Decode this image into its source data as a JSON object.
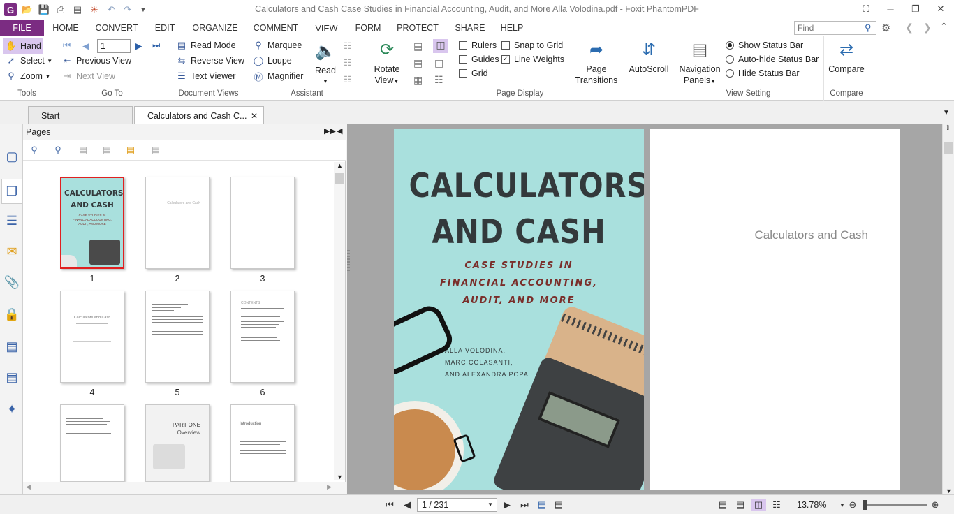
{
  "window": {
    "title": "Calculators and Cash Case Studies in Financial Accounting, Audit, and More Alla Volodina.pdf - Foxit PhantomPDF"
  },
  "ribbon_tabs": [
    "FILE",
    "HOME",
    "CONVERT",
    "EDIT",
    "ORGANIZE",
    "COMMENT",
    "VIEW",
    "FORM",
    "PROTECT",
    "SHARE",
    "HELP"
  ],
  "find": {
    "placeholder": "Find"
  },
  "tools": {
    "hand": "Hand",
    "select": "Select",
    "zoom": "Zoom",
    "label": "Tools"
  },
  "goto": {
    "page_value": "1",
    "previous_view": "Previous View",
    "next_view": "Next View",
    "label": "Go To"
  },
  "document_views": {
    "read_mode": "Read Mode",
    "reverse_view": "Reverse View",
    "text_viewer": "Text Viewer",
    "label": "Document Views"
  },
  "assistant": {
    "marquee": "Marquee",
    "loupe": "Loupe",
    "magnifier": "Magnifier",
    "label": "Assistant"
  },
  "read": {
    "label": "Read"
  },
  "rotate": {
    "line1": "Rotate",
    "line2": "View"
  },
  "page_display": {
    "rulers": "Rulers",
    "guides": "Guides",
    "grid": "Grid",
    "snap_to_grid": "Snap to Grid",
    "line_weights": "Line Weights",
    "page_transitions_1": "Page",
    "page_transitions_2": "Transitions",
    "autoscroll": "AutoScroll",
    "label": "Page Display"
  },
  "view_setting": {
    "nav_1": "Navigation",
    "nav_2": "Panels",
    "show_status": "Show Status Bar",
    "autohide_status": "Auto-hide Status Bar",
    "hide_status": "Hide Status Bar",
    "label": "View Setting"
  },
  "compare": {
    "button": "Compare",
    "label": "Compare"
  },
  "doc_tabs": {
    "start": "Start",
    "current": "Calculators and Cash C..."
  },
  "pages_panel": {
    "title": "Pages",
    "thumb_numbers": [
      "1",
      "2",
      "3",
      "4",
      "5",
      "6"
    ],
    "thumb2_text": "Calculators and Cash",
    "thumb4_title": "Calculators and Cash",
    "thumb6_heading": "CONTENTS",
    "thumb8_title": "PART ONE",
    "thumb8_sub": "Overview",
    "thumb9_heading": "Introduction",
    "thumb1_title": "CALCULATORS AND CASH",
    "thumb1_sub": "CASE STUDIES IN FINANCIAL ACCOUNTING, AUDIT, AND MORE"
  },
  "cover": {
    "title1": "CALCULATORS",
    "title2": "AND CASH",
    "sub1": "CASE STUDIES IN",
    "sub2": "FINANCIAL ACCOUNTING,",
    "sub3": "AUDIT, AND MORE",
    "author1": "ALLA VOLODINA,",
    "author2": "MARC COLASANTI,",
    "author3": "AND ALEXANDRA POPA",
    "bg_color": "#a9e0dd",
    "title_color": "#33393b",
    "sub_color": "#7a2e2a"
  },
  "page2": {
    "text": "Calculators and Cash"
  },
  "status": {
    "page_field": "1 / 231",
    "zoom": "13.78%"
  },
  "colors": {
    "file_tab": "#7b2c82",
    "selection": "#d9c6ee",
    "thumb_selected_border": "#e02020"
  }
}
